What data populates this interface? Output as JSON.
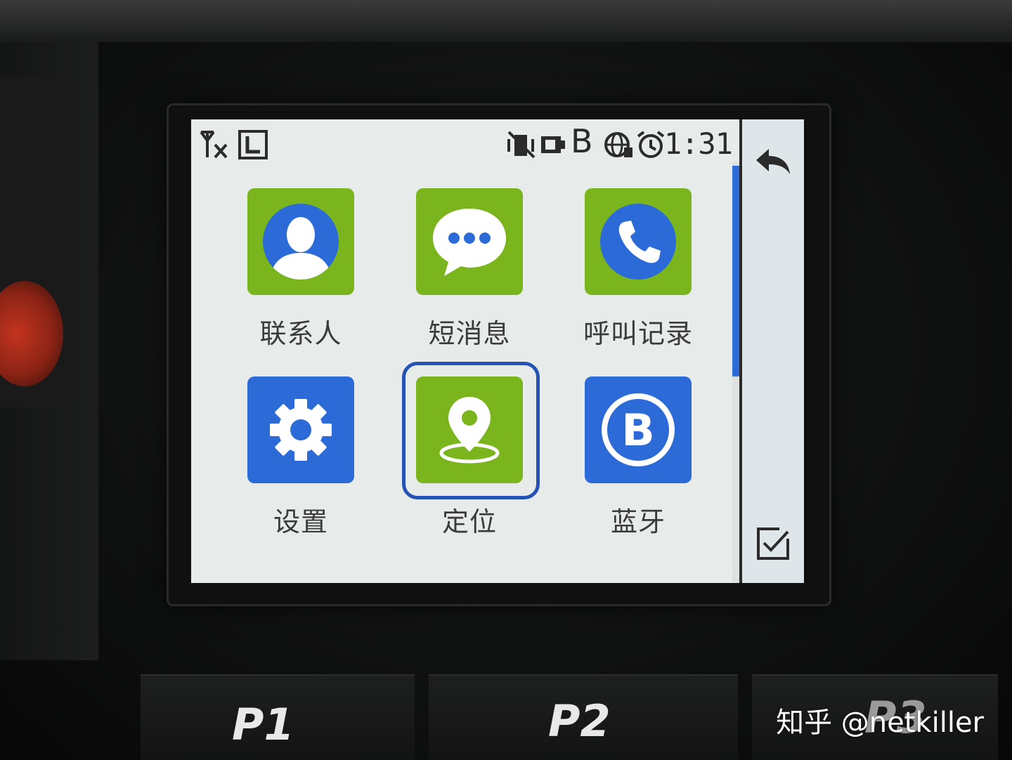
{
  "status_bar": {
    "time": "1:31",
    "icons": [
      "antenna-off-icon",
      "l-box-icon",
      "vibrate-mute-icon",
      "battery-icon",
      "bluetooth-b-icon",
      "globe-icon",
      "alarm-icon"
    ],
    "bluetooth_letter": "B"
  },
  "apps": [
    {
      "label": "联系人",
      "icon": "contacts-icon",
      "tile_color": "#7ab51d"
    },
    {
      "label": "短消息",
      "icon": "messages-icon",
      "tile_color": "#7ab51d"
    },
    {
      "label": "呼叫记录",
      "icon": "call-log-icon",
      "tile_color": "#7ab51d"
    },
    {
      "label": "设置",
      "icon": "settings-gear-icon",
      "tile_color": "#2c6ad8"
    },
    {
      "label": "定位",
      "icon": "location-pin-icon",
      "tile_color": "#7ab51d",
      "selected": true
    },
    {
      "label": "蓝牙",
      "icon": "bluetooth-icon",
      "tile_color": "#2c6ad8",
      "glyph": "B"
    }
  ],
  "softkeys": {
    "back": "back-arrow-icon",
    "confirm": "checkbox-check-icon"
  },
  "hardware_buttons": {
    "p1": "P1",
    "p2": "P2",
    "p3": "P3"
  },
  "watermark": "知乎 @netkiller",
  "colors": {
    "green": "#7ab51d",
    "blue": "#2c6ad8",
    "selection": "#2452b5",
    "screen_bg": "#e7ecea"
  }
}
